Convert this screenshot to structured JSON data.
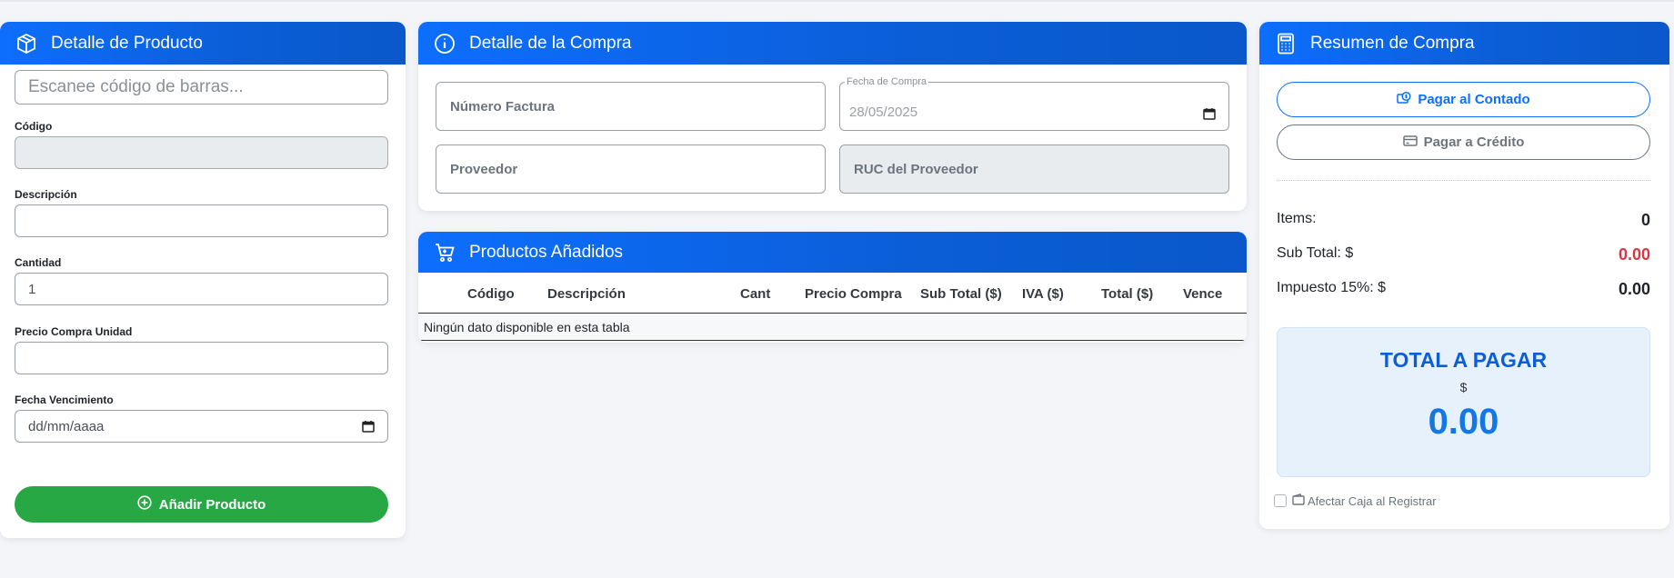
{
  "producto": {
    "title": "Detalle de Producto",
    "barcode_placeholder": "Escanee código de barras...",
    "codigo_label": "Código",
    "codigo_value": "",
    "descripcion_label": "Descripción",
    "descripcion_value": "",
    "cantidad_label": "Cantidad",
    "cantidad_value": "1",
    "precio_label": "Precio Compra Unidad",
    "precio_value": "",
    "vencimiento_label": "Fecha Vencimiento",
    "vencimiento_value": "dd/mm/aaaa",
    "add_button": "Añadir Producto"
  },
  "compra": {
    "title": "Detalle de la Compra",
    "factura_placeholder": "Número Factura",
    "fecha_label": "Fecha de Compra",
    "fecha_value": "28/05/2025",
    "proveedor_placeholder": "Proveedor",
    "ruc_placeholder": "RUC del Proveedor"
  },
  "productos": {
    "title": "Productos Añadidos",
    "columns": [
      "Código",
      "Descripción",
      "Cant",
      "Precio Compra",
      "Sub Total ($)",
      "IVA ($)",
      "Total ($)",
      "Vence"
    ],
    "empty_text": "Ningún dato disponible en esta tabla"
  },
  "resumen": {
    "title": "Resumen de Compra",
    "pagar_contado": "Pagar al Contado",
    "pagar_credito": "Pagar a Crédito",
    "items_label": "Items:",
    "items_value": "0",
    "subtotal_label": "Sub Total: $",
    "subtotal_value": "0.00",
    "impuesto_label": "Impuesto 15%: $",
    "impuesto_value": "0.00",
    "total_title": "TOTAL A PAGAR",
    "total_currency": "$",
    "total_value": "0.00",
    "afectar_caja": "Afectar Caja al Registrar"
  },
  "colors": {
    "header_blue": "#0d6efd",
    "success_green": "#28a745",
    "subtotal_red": "#dc3545",
    "total_blue": "#1477e6"
  },
  "icons": [
    "box-icon",
    "info-icon",
    "cart-icon",
    "calculator-icon",
    "plus-circle-icon",
    "cash-icon",
    "credit-card-icon",
    "wallet-icon",
    "calendar-icon"
  ]
}
